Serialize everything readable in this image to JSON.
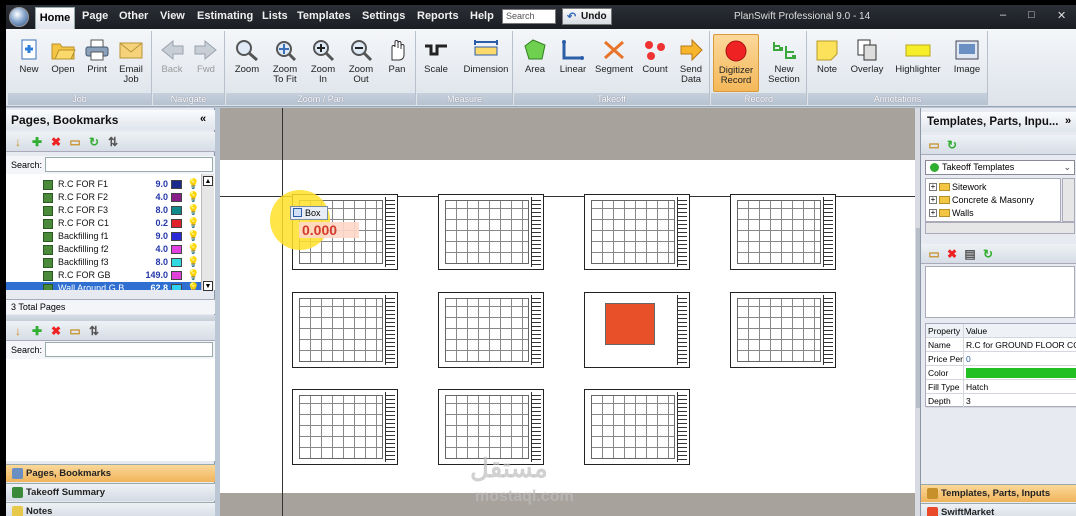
{
  "menu": {
    "items": [
      "Home",
      "Page",
      "Other",
      "View",
      "Estimating",
      "Lists",
      "Templates",
      "Settings",
      "Reports",
      "Help"
    ],
    "search_placeholder": "Search",
    "undo_label": "Undo",
    "title": "PlanSwift Professional 9.0 - 14",
    "window_controls": [
      "–",
      "□",
      "✕"
    ]
  },
  "ribbon": {
    "groups": {
      "job": "Job",
      "navigate": "Navigate",
      "zoom": "Zoom / Pan",
      "measure": "Measure",
      "takeoff": "Takeoff",
      "record": "Record",
      "annotations": "Annotations"
    },
    "buttons": {
      "new": "New",
      "open": "Open",
      "print": "Print",
      "email": "Email\nJob",
      "back": "Back",
      "fwd": "Fwd",
      "zoom": "Zoom",
      "zoom_fit": "Zoom\nTo Fit",
      "zoom_in": "Zoom\nIn",
      "zoom_out": "Zoom\nOut",
      "pan": "Pan",
      "scale": "Scale",
      "dimension": "Dimension",
      "area": "Area",
      "linear": "Linear",
      "segment": "Segment",
      "count": "Count",
      "send_data": "Send\nData",
      "digitizer": "Digitizer\nRecord",
      "new_section": "New\nSection",
      "note": "Note",
      "overlay": "Overlay",
      "highlighter": "Highlighter",
      "image": "Image"
    }
  },
  "left_pane": {
    "title": "Pages, Bookmarks",
    "search_label": "Search:",
    "items": [
      {
        "name": "R.C FOR F1",
        "value": "9.0",
        "color": "#1b2a8c"
      },
      {
        "name": "R.C FOR F2",
        "value": "4.0",
        "color": "#8a1f8a"
      },
      {
        "name": "R.C FOR F3",
        "value": "8.0",
        "color": "#0f8a8a"
      },
      {
        "name": "R.C FOR C1",
        "value": "0.2",
        "color": "#e0202a"
      },
      {
        "name": "Backfilling f1",
        "value": "9.0",
        "color": "#2a2ad8"
      },
      {
        "name": "Backfilling f2",
        "value": "4.0",
        "color": "#e040e0"
      },
      {
        "name": "Backfilling f3",
        "value": "8.0",
        "color": "#30d8e0"
      },
      {
        "name": "R.C FOR GB",
        "value": "149.0",
        "color": "#e040d8"
      },
      {
        "name": "Wall Around G.B",
        "value": "62.8",
        "color": "#30d0f0",
        "selected": true
      }
    ],
    "total_pages": "3 Total Pages",
    "search_label_2": "Search:",
    "bottom_tabs": [
      "Pages, Bookmarks",
      "Takeoff Summary",
      "Notes"
    ]
  },
  "canvas": {
    "tooltip_label": "Box",
    "measure_value": "0.000",
    "watermark_1": "مستقل",
    "watermark_2": "mostaql.com"
  },
  "right_pane": {
    "title": "Templates, Parts, Inpu...",
    "template_select": "Takeoff Templates",
    "tree": [
      "Sitework",
      "Concrete & Masonry",
      "Walls"
    ],
    "props_header": {
      "k": "Property",
      "v": "Value"
    },
    "props": [
      {
        "k": "Name",
        "v": "R.C for GROUND FLOOR COL"
      },
      {
        "k": "Price Per",
        "v": "0"
      },
      {
        "k": "Color",
        "v": ""
      },
      {
        "k": "Fill Type",
        "v": "Hatch"
      },
      {
        "k": "Depth",
        "v": "3"
      }
    ],
    "bottom_tabs": [
      "Templates, Parts, Inputs",
      "SwiftMarket"
    ]
  },
  "colors": {
    "accent": "#2e6fd1",
    "active_record": "#f4b85a",
    "prop_color": "#22c022"
  }
}
